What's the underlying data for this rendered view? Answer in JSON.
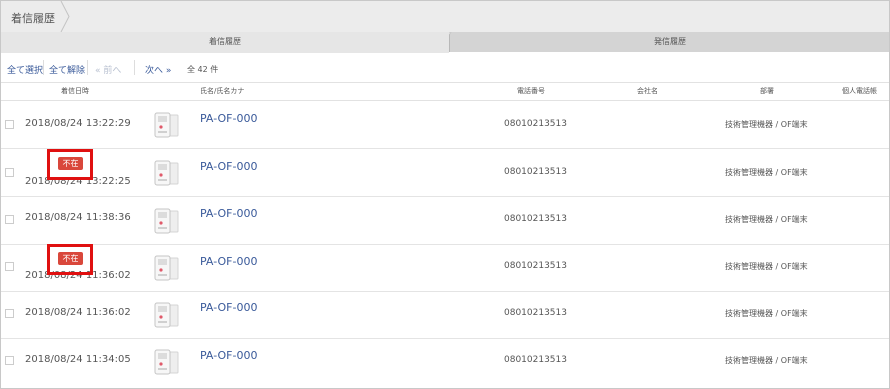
{
  "breadcrumb": {
    "label": "着信履歴"
  },
  "tabs": [
    {
      "label": "着信履歴",
      "active": true
    },
    {
      "label": "発信履歴",
      "active": false
    }
  ],
  "toolbar": {
    "select_all": "全て選択",
    "deselect_all": "全て解除",
    "prev": "前へ",
    "next": "次へ",
    "total": "全 42 件"
  },
  "columns": {
    "datetime": "着信日時",
    "name": "氏名/氏名カナ",
    "phone": "電話番号",
    "company": "会社名",
    "department": "部署",
    "personal_phone": "個人電話帳"
  },
  "rows": [
    {
      "datetime": "2018/08/24 13:22:29",
      "missed": false,
      "name": "PA-OF-000",
      "phone": "08010213513",
      "department": "技術管理機器 / OF端末"
    },
    {
      "datetime": "2018/08/24 13:22:25",
      "missed": true,
      "badge": "不在",
      "name": "PA-OF-000",
      "phone": "08010213513",
      "department": "技術管理機器 / OF端末"
    },
    {
      "datetime": "2018/08/24 11:38:36",
      "missed": false,
      "name": "PA-OF-000",
      "phone": "08010213513",
      "department": "技術管理機器 / OF端末"
    },
    {
      "datetime": "2018/08/24 11:36:02",
      "missed": true,
      "badge": "不在",
      "name": "PA-OF-000",
      "phone": "08010213513",
      "department": "技術管理機器 / OF端末"
    },
    {
      "datetime": "2018/08/24 11:36:02",
      "missed": false,
      "name": "PA-OF-000",
      "phone": "08010213513",
      "department": "技術管理機器 / OF端末"
    },
    {
      "datetime": "2018/08/24 11:34:05",
      "missed": false,
      "name": "PA-OF-000",
      "phone": "08010213513",
      "department": "技術管理機器 / OF端末"
    }
  ],
  "colors": {
    "badge": "#d9473b",
    "highlight": "#e01010",
    "link": "#3a5a9a"
  },
  "icons": {
    "row": "desk-phone-icon",
    "prev": "double-chevron-left-icon",
    "next": "double-chevron-right-icon"
  }
}
